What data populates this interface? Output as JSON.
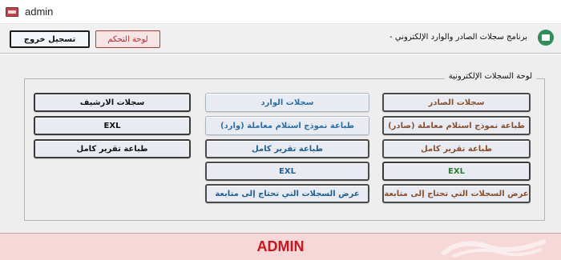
{
  "window": {
    "title": "admin"
  },
  "header": {
    "title": "برنامج سجلات الصادر والوارد الإلكتروني -",
    "logout_label": "تسجيل خروج",
    "panel_label": "لوحة التحكم"
  },
  "group": {
    "label": "لوحة السجلات الإلكترونية",
    "col_outgoing": [
      "سجلات الصادر",
      "طباعة نموذج استلام معاملة (صادر)",
      "طباعة تقرير كامل",
      "EXL",
      "عرض السجلات التي تحتاج إلى متابعة"
    ],
    "col_incoming": [
      "سجلات الوارد",
      "طباعة نموذج استلام معاملة (وارد)",
      "طباعة تقرير كامل",
      "EXL",
      "عرض السجلات التي تحتاج إلى متابعة"
    ],
    "col_archive": [
      "سجلات الارشيف",
      "EXL",
      "طباعة تقرير كامل"
    ]
  },
  "footer": {
    "title": "ADMIN"
  },
  "colors": {
    "header_bg": "#f0f0f0",
    "main_bg": "#eeeeee",
    "footer_bg": "#f6d8d8",
    "footer_text": "#d0121b",
    "outgoing_text": "#8a4e2b",
    "incoming_text": "#2c6fa8",
    "exl_green": "#2f7a32"
  }
}
